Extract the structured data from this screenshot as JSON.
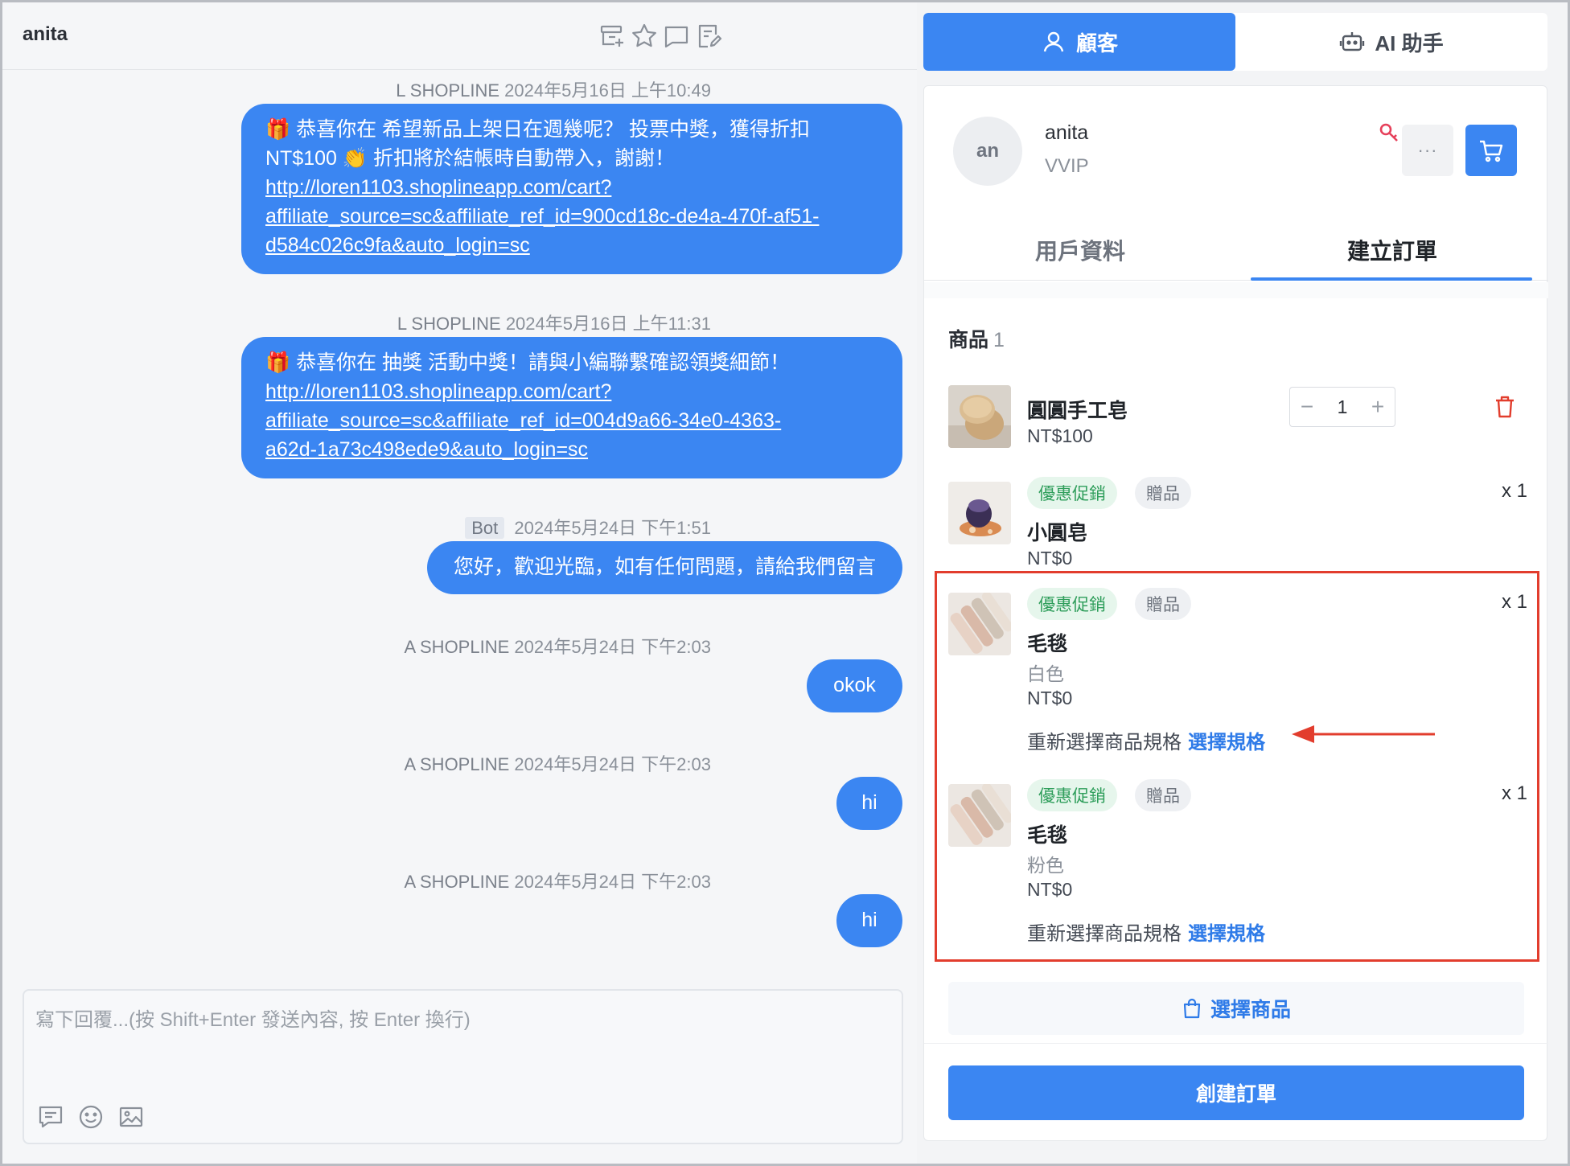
{
  "chat": {
    "contact_name": "anita",
    "composer_placeholder": "寫下回覆...(按 Shift+Enter 發送內容, 按 Enter 換行)",
    "messages": [
      {
        "sender": "L SHOPLINE",
        "time": "2024年5月16日 上午10:49",
        "lines": [
          "🎁 恭喜你在 希望新品上架日在週幾呢？ 投票中獎，獲得折扣",
          "NT$100 👏 折扣將於結帳時自動帶入，謝謝！"
        ],
        "link_lines": [
          "http://loren1103.shoplineapp.com/cart?",
          "affiliate_source=sc&affiliate_ref_id=900cd18c-de4a-470f-af51-",
          "d584c026c9fa&auto_login=sc"
        ]
      },
      {
        "sender": "L SHOPLINE",
        "time": "2024年5月16日 上午11:31",
        "lines": [
          "🎁 恭喜你在 抽獎 活動中獎！請與小編聯繫確認領獎細節！"
        ],
        "link_lines": [
          "http://loren1103.shoplineapp.com/cart?",
          "affiliate_source=sc&affiliate_ref_id=004d9a66-34e0-4363-",
          "a62d-1a73c498ede9&auto_login=sc"
        ]
      },
      {
        "badge": "Bot",
        "time": "2024年5月24日 下午1:51",
        "text": "您好，歡迎光臨，如有任何問題，請給我們留言"
      },
      {
        "sender": "A SHOPLINE",
        "time": "2024年5月24日 下午2:03",
        "text": "okok"
      },
      {
        "sender": "A SHOPLINE",
        "time": "2024年5月24日 下午2:03",
        "text": "hi"
      },
      {
        "sender": "A SHOPLINE",
        "time": "2024年5月24日 下午2:03",
        "text": "hi"
      }
    ]
  },
  "top_tabs": {
    "customer": "顧客",
    "ai": "AI 助手"
  },
  "customer": {
    "avatar_initials": "an",
    "name": "anita",
    "level": "VVIP",
    "more_label": "···"
  },
  "sub_tabs": {
    "profile": "用戶資料",
    "create_order": "建立訂單"
  },
  "order": {
    "section_label": "商品",
    "section_count": "1",
    "main_item": {
      "name": "圓圓手工皂",
      "price": "NT$100",
      "quantity": "1",
      "minus": "−",
      "plus": "+"
    },
    "gifts": [
      {
        "tag_promo": "優惠促銷",
        "tag_gift": "贈品",
        "name": "小圓皂",
        "variant": "",
        "price": "NT$0",
        "qty": "x 1"
      },
      {
        "tag_promo": "優惠促銷",
        "tag_gift": "贈品",
        "name": "毛毯",
        "variant": "白色",
        "price": "NT$0",
        "qty": "x 1",
        "reselect_text": "重新選擇商品規格",
        "reselect_link": "選擇規格"
      },
      {
        "tag_promo": "優惠促銷",
        "tag_gift": "贈品",
        "name": "毛毯",
        "variant": "粉色",
        "price": "NT$0",
        "qty": "x 1",
        "reselect_text": "重新選擇商品規格",
        "reselect_link": "選擇規格"
      }
    ],
    "select_product_label": "選擇商品",
    "create_order_label": "創建訂單"
  },
  "colors": {
    "accent": "#3b86f2",
    "highlight": "#e23d2d",
    "promo": "#2f9e5b"
  }
}
